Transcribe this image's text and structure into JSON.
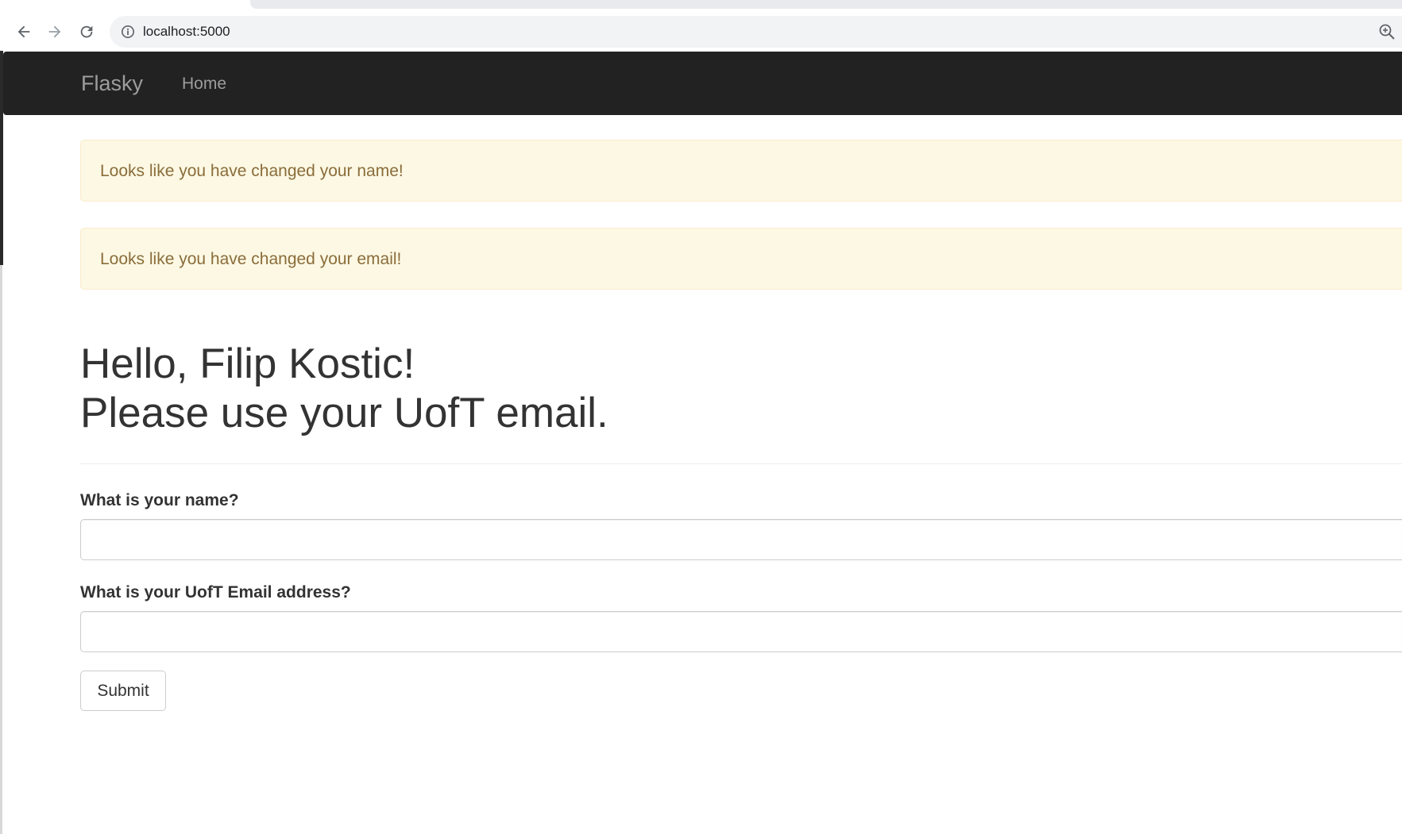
{
  "browser": {
    "url": "localhost:5000",
    "icons": {
      "back": "arrow-left-icon",
      "forward": "arrow-right-icon",
      "reload": "reload-icon",
      "site_info": "info-icon",
      "zoom": "zoom-icon"
    }
  },
  "navbar": {
    "brand": "Flasky",
    "links": [
      "Home"
    ],
    "background": "#222222"
  },
  "alerts": [
    "Looks like you have changed your name!",
    "Looks like you have changed your email!"
  ],
  "header": {
    "line1": "Hello, Filip Kostic!",
    "line2": "Please use your UofT email."
  },
  "form": {
    "name_label": "What is your name?",
    "name_value": "",
    "email_label": "What is your UofT Email address?",
    "email_value": "",
    "submit_label": "Submit"
  },
  "colors": {
    "alert_bg": "#fcf8e3",
    "alert_text": "#8a6d3b"
  }
}
